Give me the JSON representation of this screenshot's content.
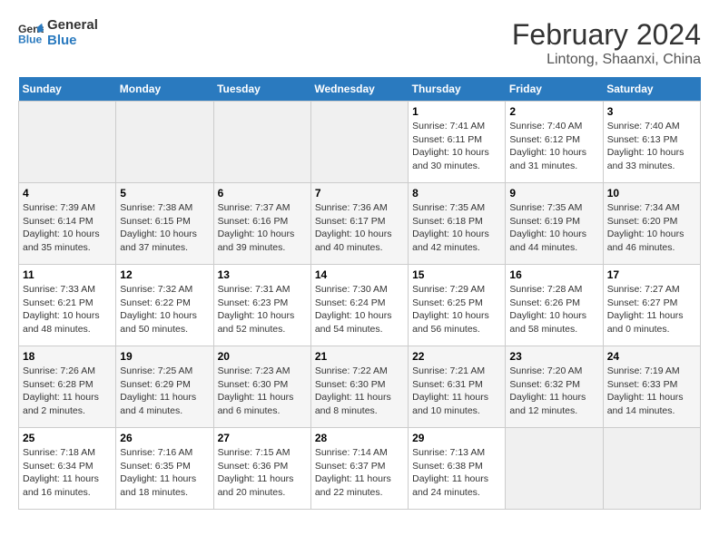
{
  "logo": {
    "line1": "General",
    "line2": "Blue"
  },
  "title": "February 2024",
  "subtitle": "Lintong, Shaanxi, China",
  "days_header": [
    "Sunday",
    "Monday",
    "Tuesday",
    "Wednesday",
    "Thursday",
    "Friday",
    "Saturday"
  ],
  "weeks": [
    [
      {
        "num": "",
        "info": ""
      },
      {
        "num": "",
        "info": ""
      },
      {
        "num": "",
        "info": ""
      },
      {
        "num": "",
        "info": ""
      },
      {
        "num": "1",
        "info": "Sunrise: 7:41 AM\nSunset: 6:11 PM\nDaylight: 10 hours\nand 30 minutes."
      },
      {
        "num": "2",
        "info": "Sunrise: 7:40 AM\nSunset: 6:12 PM\nDaylight: 10 hours\nand 31 minutes."
      },
      {
        "num": "3",
        "info": "Sunrise: 7:40 AM\nSunset: 6:13 PM\nDaylight: 10 hours\nand 33 minutes."
      }
    ],
    [
      {
        "num": "4",
        "info": "Sunrise: 7:39 AM\nSunset: 6:14 PM\nDaylight: 10 hours\nand 35 minutes."
      },
      {
        "num": "5",
        "info": "Sunrise: 7:38 AM\nSunset: 6:15 PM\nDaylight: 10 hours\nand 37 minutes."
      },
      {
        "num": "6",
        "info": "Sunrise: 7:37 AM\nSunset: 6:16 PM\nDaylight: 10 hours\nand 39 minutes."
      },
      {
        "num": "7",
        "info": "Sunrise: 7:36 AM\nSunset: 6:17 PM\nDaylight: 10 hours\nand 40 minutes."
      },
      {
        "num": "8",
        "info": "Sunrise: 7:35 AM\nSunset: 6:18 PM\nDaylight: 10 hours\nand 42 minutes."
      },
      {
        "num": "9",
        "info": "Sunrise: 7:35 AM\nSunset: 6:19 PM\nDaylight: 10 hours\nand 44 minutes."
      },
      {
        "num": "10",
        "info": "Sunrise: 7:34 AM\nSunset: 6:20 PM\nDaylight: 10 hours\nand 46 minutes."
      }
    ],
    [
      {
        "num": "11",
        "info": "Sunrise: 7:33 AM\nSunset: 6:21 PM\nDaylight: 10 hours\nand 48 minutes."
      },
      {
        "num": "12",
        "info": "Sunrise: 7:32 AM\nSunset: 6:22 PM\nDaylight: 10 hours\nand 50 minutes."
      },
      {
        "num": "13",
        "info": "Sunrise: 7:31 AM\nSunset: 6:23 PM\nDaylight: 10 hours\nand 52 minutes."
      },
      {
        "num": "14",
        "info": "Sunrise: 7:30 AM\nSunset: 6:24 PM\nDaylight: 10 hours\nand 54 minutes."
      },
      {
        "num": "15",
        "info": "Sunrise: 7:29 AM\nSunset: 6:25 PM\nDaylight: 10 hours\nand 56 minutes."
      },
      {
        "num": "16",
        "info": "Sunrise: 7:28 AM\nSunset: 6:26 PM\nDaylight: 10 hours\nand 58 minutes."
      },
      {
        "num": "17",
        "info": "Sunrise: 7:27 AM\nSunset: 6:27 PM\nDaylight: 11 hours\nand 0 minutes."
      }
    ],
    [
      {
        "num": "18",
        "info": "Sunrise: 7:26 AM\nSunset: 6:28 PM\nDaylight: 11 hours\nand 2 minutes."
      },
      {
        "num": "19",
        "info": "Sunrise: 7:25 AM\nSunset: 6:29 PM\nDaylight: 11 hours\nand 4 minutes."
      },
      {
        "num": "20",
        "info": "Sunrise: 7:23 AM\nSunset: 6:30 PM\nDaylight: 11 hours\nand 6 minutes."
      },
      {
        "num": "21",
        "info": "Sunrise: 7:22 AM\nSunset: 6:30 PM\nDaylight: 11 hours\nand 8 minutes."
      },
      {
        "num": "22",
        "info": "Sunrise: 7:21 AM\nSunset: 6:31 PM\nDaylight: 11 hours\nand 10 minutes."
      },
      {
        "num": "23",
        "info": "Sunrise: 7:20 AM\nSunset: 6:32 PM\nDaylight: 11 hours\nand 12 minutes."
      },
      {
        "num": "24",
        "info": "Sunrise: 7:19 AM\nSunset: 6:33 PM\nDaylight: 11 hours\nand 14 minutes."
      }
    ],
    [
      {
        "num": "25",
        "info": "Sunrise: 7:18 AM\nSunset: 6:34 PM\nDaylight: 11 hours\nand 16 minutes."
      },
      {
        "num": "26",
        "info": "Sunrise: 7:16 AM\nSunset: 6:35 PM\nDaylight: 11 hours\nand 18 minutes."
      },
      {
        "num": "27",
        "info": "Sunrise: 7:15 AM\nSunset: 6:36 PM\nDaylight: 11 hours\nand 20 minutes."
      },
      {
        "num": "28",
        "info": "Sunrise: 7:14 AM\nSunset: 6:37 PM\nDaylight: 11 hours\nand 22 minutes."
      },
      {
        "num": "29",
        "info": "Sunrise: 7:13 AM\nSunset: 6:38 PM\nDaylight: 11 hours\nand 24 minutes."
      },
      {
        "num": "",
        "info": ""
      },
      {
        "num": "",
        "info": ""
      }
    ]
  ]
}
